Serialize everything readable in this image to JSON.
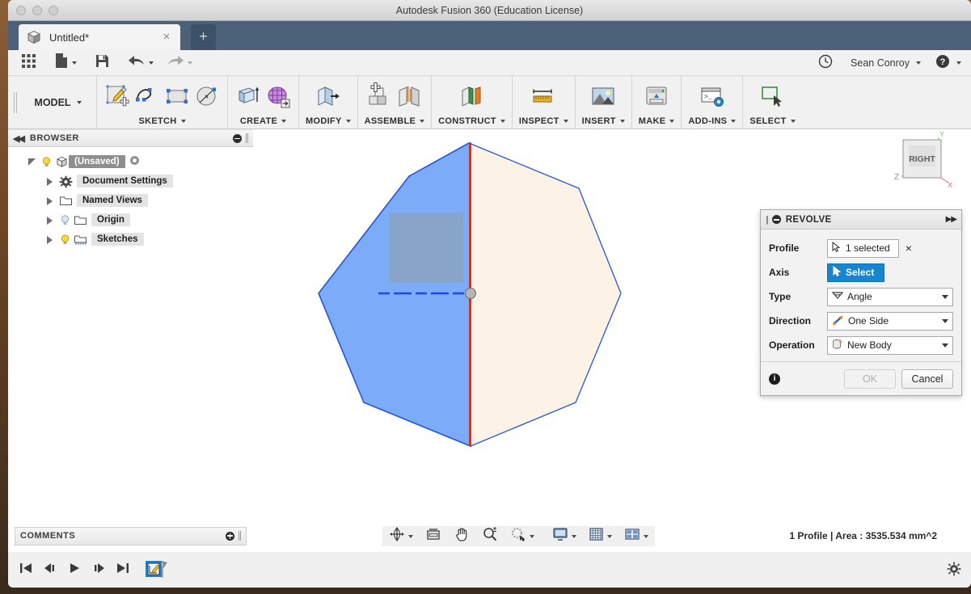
{
  "window": {
    "title": "Autodesk Fusion 360 (Education License)",
    "controls": [
      "close",
      "minimize",
      "zoom"
    ]
  },
  "tab": {
    "label": "Untitled*",
    "close_label": "×",
    "new_tab_label": "+",
    "cube_icon": "document-cube-icon"
  },
  "quickaccess": {
    "grid_icon": "app-grid-icon",
    "file_label": "File",
    "save_icon": "save-icon",
    "undo_icon": "undo-icon",
    "redo_icon": "redo-icon",
    "history_icon": "job-status-clock-icon",
    "user_name": "Sean Conroy",
    "help_icon": "help-icon"
  },
  "ribbon": {
    "workspace_label": "MODEL",
    "groups": [
      {
        "label": "SKETCH",
        "icons": [
          "create-sketch-icon",
          "line-icon",
          "rectangle-icon",
          "circle-icon"
        ]
      },
      {
        "label": "CREATE",
        "icons": [
          "extrude-icon",
          "form-icon"
        ]
      },
      {
        "label": "MODIFY",
        "icons": [
          "press-pull-icon"
        ]
      },
      {
        "label": "ASSEMBLE",
        "icons": [
          "new-component-icon",
          "joint-icon"
        ]
      },
      {
        "label": "CONSTRUCT",
        "icons": [
          "offset-plane-icon"
        ]
      },
      {
        "label": "INSPECT",
        "icons": [
          "measure-icon"
        ]
      },
      {
        "label": "INSERT",
        "icons": [
          "insert-image-icon"
        ]
      },
      {
        "label": "MAKE",
        "icons": [
          "3d-print-icon"
        ]
      },
      {
        "label": "ADD-INS",
        "icons": [
          "scripts-addins-icon"
        ]
      },
      {
        "label": "SELECT",
        "icons": [
          "select-icon"
        ]
      }
    ]
  },
  "browser": {
    "title": "BROWSER",
    "collapse_icon": "collapse-left-icon",
    "minimize_icon": "minimize-icon",
    "tree": [
      {
        "label": "(Unsaved)",
        "indent": 0,
        "expander": "open",
        "bulb": true,
        "icon": "component-cube-icon",
        "selected": true,
        "eye": true
      },
      {
        "label": "Document Settings",
        "indent": 1,
        "expander": "closed",
        "bulb": false,
        "icon": "gear-icon",
        "selected": false,
        "eye": false
      },
      {
        "label": "Named Views",
        "indent": 1,
        "expander": "closed",
        "bulb": false,
        "icon": "folder-icon",
        "selected": false,
        "eye": false
      },
      {
        "label": "Origin",
        "indent": 1,
        "expander": "closed",
        "bulb": true,
        "icon": "folder-icon",
        "selected": false,
        "eye": false
      },
      {
        "label": "Sketches",
        "indent": 1,
        "expander": "closed",
        "bulb": true,
        "icon": "sketch-folder-icon",
        "selected": false,
        "eye": false
      }
    ]
  },
  "canvas": {
    "viewcube_face": "RIGHT",
    "axis_labels": {
      "x": "X",
      "y": "Y",
      "z": "Z"
    },
    "axis_colors": {
      "x": "#e04b4b",
      "y": "#5cbf4a",
      "z": "#4a7fe0"
    },
    "profile": {
      "shape": "heptagon",
      "selected_fill": "#7CABF7",
      "unselected_fill": "#FDF2E6",
      "edge_color": "#2255dd",
      "rect_fill": "#8aa3c4",
      "axis_line_color": "#e8130f",
      "construction_line_color": "#1d49e0",
      "origin_point_color": "#9a9a9a"
    }
  },
  "revolve_dialog": {
    "title": "REVOLVE",
    "collapse_icon": "minus-circle-icon",
    "expand_icon": "expand-right-icon",
    "rows": [
      {
        "label": "Profile",
        "value": "1 selected",
        "icon": "cursor-select-icon",
        "control": "selection",
        "highlighted": false,
        "has_clear": true,
        "clear_label": "×"
      },
      {
        "label": "Axis",
        "value": "Select",
        "icon": "cursor-select-icon",
        "control": "selection",
        "highlighted": true,
        "has_clear": false,
        "clear_label": ""
      },
      {
        "label": "Type",
        "value": "Angle",
        "icon": "angle-icon",
        "control": "dropdown",
        "highlighted": false,
        "has_clear": false,
        "clear_label": ""
      },
      {
        "label": "Direction",
        "value": "One Side",
        "icon": "one-side-icon",
        "control": "dropdown",
        "highlighted": false,
        "has_clear": false,
        "clear_label": ""
      },
      {
        "label": "Operation",
        "value": "New Body",
        "icon": "new-body-icon",
        "control": "dropdown",
        "highlighted": false,
        "has_clear": false,
        "clear_label": ""
      }
    ],
    "info_icon": "info-icon",
    "ok_label": "OK",
    "ok_enabled": false,
    "cancel_label": "Cancel",
    "accent_color": "#1785d0"
  },
  "comments": {
    "title": "COMMENTS",
    "add_icon": "add-comment-icon"
  },
  "status": {
    "text": "1 Profile | Area : 3535.534 mm^2",
    "nav_tools": [
      "orbit-icon",
      "fit-icon",
      "pan-icon",
      "zoom-icon",
      "zoom-window-icon",
      "display-settings-icon",
      "grid-snap-icon",
      "viewports-icon"
    ]
  },
  "timeline": {
    "controls": [
      "go-to-beginning-icon",
      "step-back-icon",
      "play-icon",
      "step-forward-icon",
      "go-to-end-icon"
    ],
    "features": [
      {
        "name": "sketch-feature",
        "icon": "sketch-feature-icon"
      }
    ],
    "settings_icon": "timeline-settings-icon"
  }
}
